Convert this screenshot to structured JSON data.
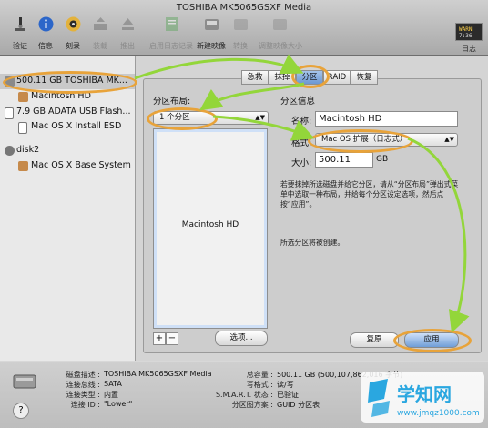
{
  "window": {
    "title": "TOSHIBA MK5065GSXF Media"
  },
  "toolbar": {
    "items": [
      {
        "label": "验证",
        "icon": "microscope-icon",
        "enabled": true
      },
      {
        "label": "信息",
        "icon": "info-icon",
        "enabled": true
      },
      {
        "label": "刻录",
        "icon": "burn-icon",
        "enabled": true
      },
      {
        "label": "装载",
        "icon": "mount-icon",
        "enabled": false
      },
      {
        "label": "推出",
        "icon": "eject-icon",
        "enabled": false
      },
      {
        "label": "启用日志记录",
        "icon": "journal-icon",
        "enabled": false
      },
      {
        "label": "新建映像",
        "icon": "new-image-icon",
        "enabled": true
      },
      {
        "label": "转换",
        "icon": "convert-icon",
        "enabled": false
      },
      {
        "label": "调整映像大小",
        "icon": "resize-image-icon",
        "enabled": false
      }
    ],
    "log_label": "日志"
  },
  "sidebar": {
    "items": [
      {
        "label": "500.11 GB TOSHIBA MK...",
        "level": 0,
        "icon": "hard-disk-icon",
        "selected": true
      },
      {
        "label": "Macintosh HD",
        "level": 1,
        "icon": "volume-icon",
        "selected": false
      },
      {
        "label": "7.9 GB ADATA USB Flash...",
        "level": 0,
        "icon": "usb-drive-icon",
        "selected": false
      },
      {
        "label": "Mac OS X Install ESD",
        "level": 1,
        "icon": "volume-icon",
        "selected": false
      },
      {
        "label": "disk2",
        "level": 0,
        "icon": "disk-image-icon",
        "selected": false
      },
      {
        "label": "Mac OS X Base System",
        "level": 1,
        "icon": "volume-icon",
        "selected": false
      }
    ]
  },
  "tabs": [
    {
      "label": "急救",
      "active": false
    },
    {
      "label": "抹掉",
      "active": false
    },
    {
      "label": "分区",
      "active": true
    },
    {
      "label": "RAID",
      "active": false
    },
    {
      "label": "恢复",
      "active": false
    }
  ],
  "partition": {
    "layout_label": "分区布局:",
    "layout_value": "1 个分区",
    "info_label": "分区信息",
    "name_label": "名称:",
    "name_value": "Macintosh HD",
    "format_label": "格式:",
    "format_value": "Mac OS 扩展（日志式）",
    "size_label": "大小:",
    "size_value": "500.11",
    "size_unit": "GB",
    "help_text": [
      "若要抹掉所选磁盘并给它分区，请从“分区布局”弹出式菜",
      "单中选取一种布局，并给每个分区设定选项，然后点",
      "按“应用”。"
    ],
    "status_text": "所选分区将被创建。",
    "block_label": "Macintosh HD",
    "add_label": "+",
    "remove_label": "−",
    "options_label": "选项...",
    "revert_label": "复原",
    "apply_label": "应用"
  },
  "footer": {
    "left": [
      {
        "key": "磁盘描述 :",
        "value": "TOSHIBA MK5065GSXF Media"
      },
      {
        "key": "连接总线 :",
        "value": "SATA"
      },
      {
        "key": "连接类型 :",
        "value": "内置"
      },
      {
        "key": "连接 ID :",
        "value": "\"Lower\""
      }
    ],
    "right": [
      {
        "key": "总容量 :",
        "value": "500.11 GB (500,107,862,016 字节)"
      },
      {
        "key": "写格式 :",
        "value": "读/写"
      },
      {
        "key": "S.M.A.R.T. 状态 :",
        "value": "已验证"
      },
      {
        "key": "分区图方案 :",
        "value": "GUID 分区表"
      }
    ],
    "help": "?"
  },
  "watermark": {
    "title": "学知网",
    "url": "www.jmqz1000.com"
  },
  "colors": {
    "annotation_ring": "#e8a33a",
    "annotation_arrow": "#93d63a",
    "selected_tab": "#7aa3d8"
  }
}
